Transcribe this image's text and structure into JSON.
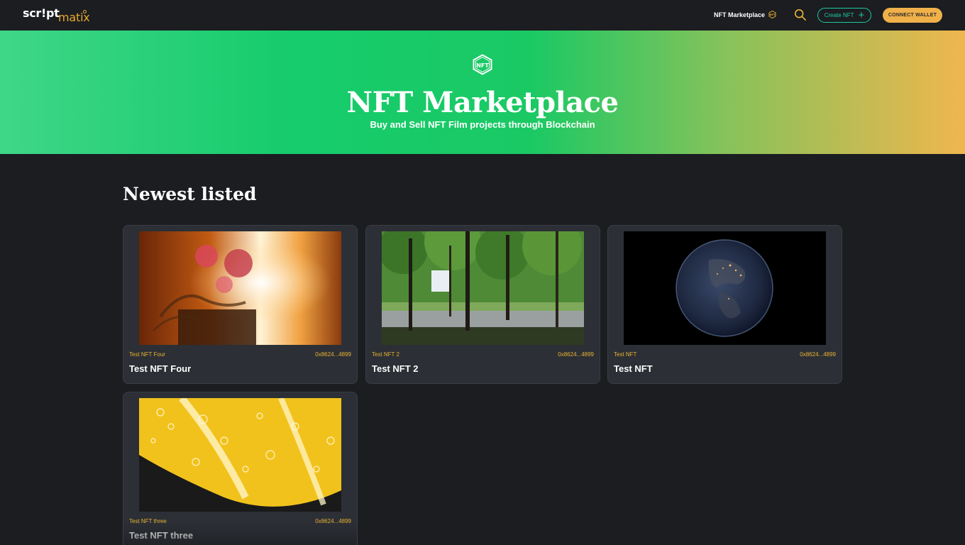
{
  "nav": {
    "logo_part1": "scr!pt",
    "logo_part2": "matix",
    "marketplace_link": "NFT Marketplace",
    "create_button": "Create NFT",
    "create_plus": "+",
    "wallet_button": "CONNECT WALLET"
  },
  "hero": {
    "title": "NFT Marketplace",
    "subtitle": "Buy and Sell NFT Film projects through Blockchain"
  },
  "section": {
    "title": "Newest listed"
  },
  "cards": [
    {
      "small_title": "Test NFT Four",
      "address": "0x8624...4899",
      "name": "Test NFT Four"
    },
    {
      "small_title": "Test NFT 2",
      "address": "0x8624...4899",
      "name": "Test NFT 2"
    },
    {
      "small_title": "Test NFT",
      "address": "0x8624...4899",
      "name": "Test NFT"
    },
    {
      "small_title": "Test NFT three",
      "address": "0x8624...4899",
      "name": "Test NFT three"
    }
  ],
  "colors": {
    "background": "#1b1d21",
    "card": "#2c2f35",
    "accent_gold": "#e8b335",
    "accent_teal": "#1fc8a0",
    "wallet_button": "#f0b04a"
  },
  "icons": {
    "nft_badge": "nft-hexagon-icon",
    "search": "search-icon",
    "plus": "plus-icon"
  }
}
